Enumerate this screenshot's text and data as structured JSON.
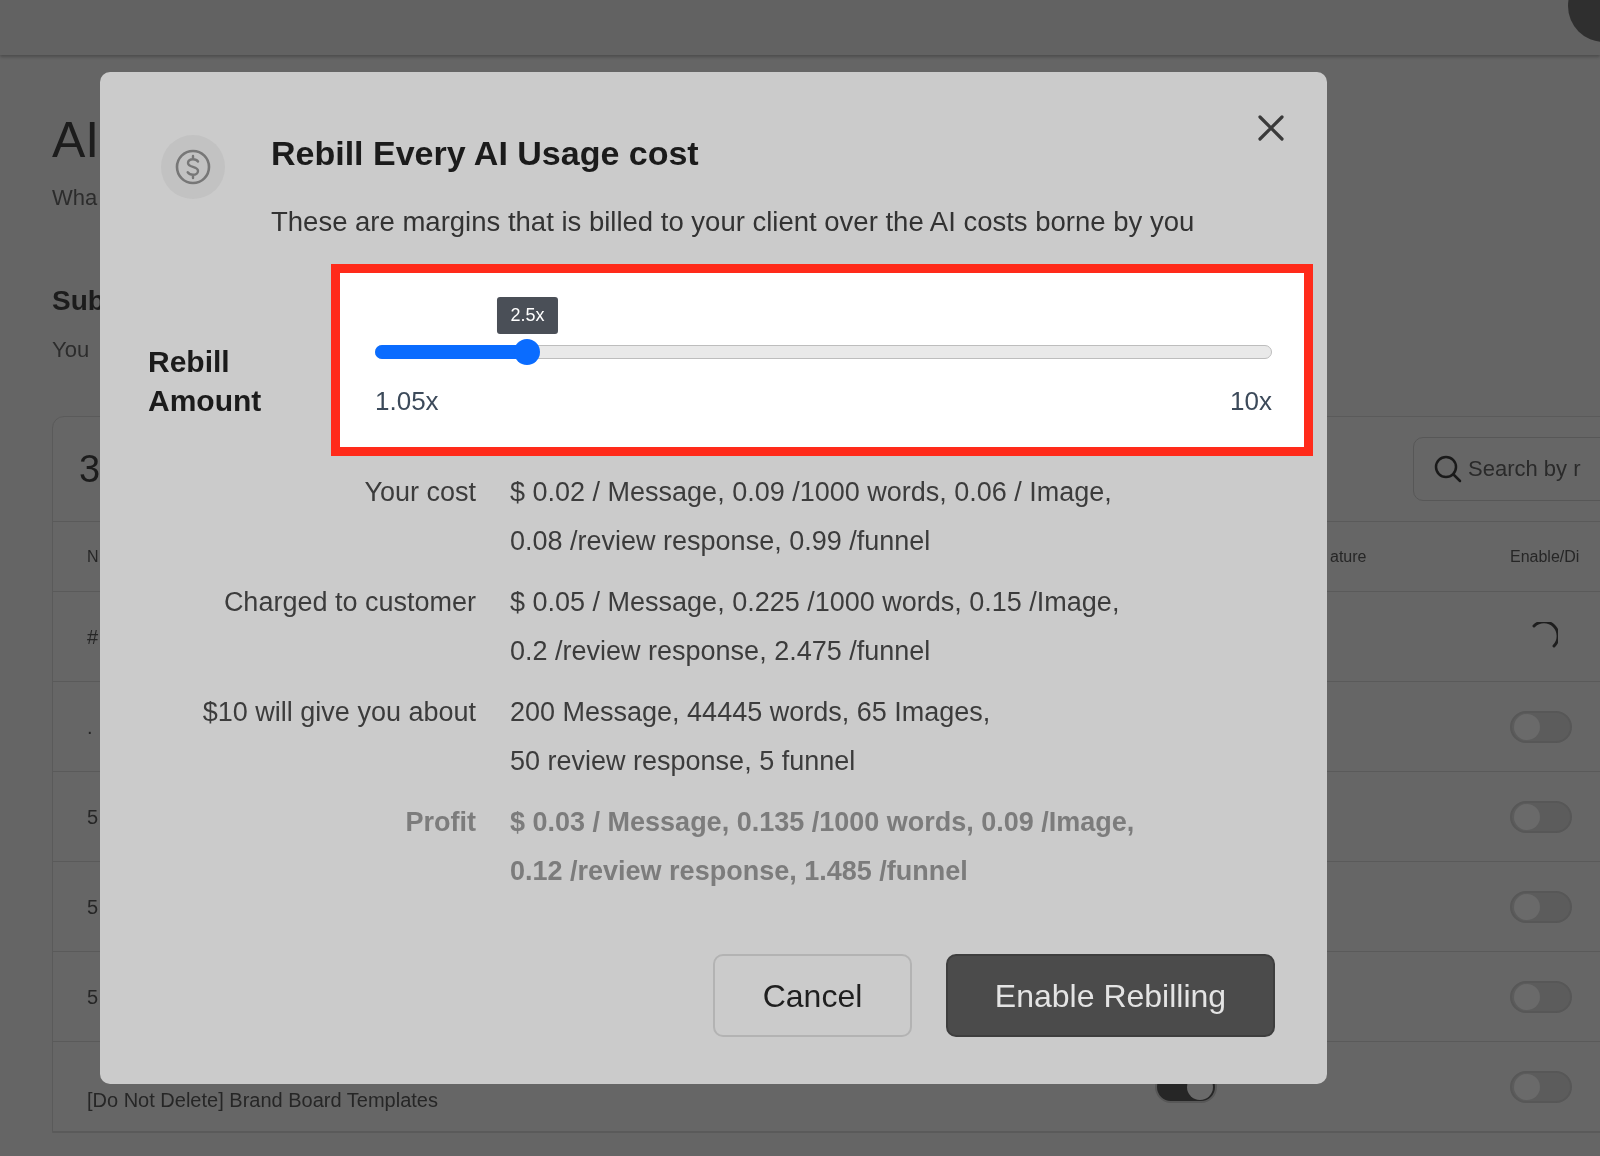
{
  "page": {
    "title": "AI",
    "subtitle": "Wha",
    "section_title": "Sub",
    "section_text": "You",
    "table": {
      "count": "3",
      "search": {
        "placeholder": "Search by r"
      },
      "columns": [
        {
          "label": "N"
        },
        {
          "label": "ature"
        },
        {
          "label": "Enable/Di"
        }
      ],
      "rows": [
        {
          "name": "#",
          "kind": "loading"
        },
        {
          "name": ".",
          "kind": "toggle",
          "enabled": false
        },
        {
          "name": "5",
          "kind": "toggle",
          "enabled": false
        },
        {
          "name": "5",
          "kind": "toggle",
          "enabled": false
        },
        {
          "name": "5",
          "kind": "toggle",
          "enabled": false
        },
        {
          "name": "[Do Not Delete] Brand Board Templates",
          "kind": "toggle",
          "enabled": false,
          "feature_toggle": {
            "on": true
          }
        }
      ]
    }
  },
  "modal": {
    "title": "Rebill Every AI Usage cost",
    "subtitle": "These are margins that is billed to your client over the AI costs borne by you",
    "slider": {
      "label": "Rebill Amount",
      "tooltip": "2.5x",
      "level": 0.17,
      "min_label": "1.05x",
      "max_label": "10x",
      "highlighted": true
    },
    "details": [
      {
        "label": "Your cost",
        "lines": [
          "$ 0.02 / Message, 0.09 /1000 words, 0.06 / Image,",
          "0.08 /review response, 0.99 /funnel"
        ],
        "kind": "normal"
      },
      {
        "label": "Charged to customer",
        "lines": [
          "$ 0.05 / Message, 0.225 /1000 words, 0.15 /Image,",
          "0.2 /review response, 2.475 /funnel"
        ],
        "kind": "normal"
      },
      {
        "label": "$10 will give you about",
        "lines": [
          "200 Message, 44445 words, 65 Images,",
          "50 review response, 5 funnel"
        ],
        "kind": "normal"
      },
      {
        "label": "Profit",
        "lines": [
          "$ 0.03 / Message, 0.135 /1000 words, 0.09 /Image,",
          "0.12 /review response, 1.485 /funnel"
        ],
        "kind": "emphasis"
      }
    ],
    "buttons": [
      {
        "label": "Cancel",
        "kind": "secondary"
      },
      {
        "label": "Enable Rebilling",
        "kind": "primary"
      }
    ]
  }
}
